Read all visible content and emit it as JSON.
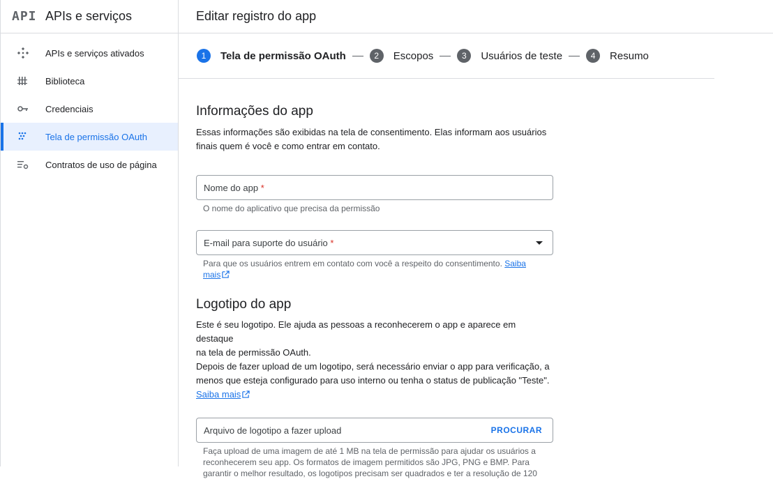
{
  "sidebar": {
    "logo": "API",
    "title": "APIs e serviços",
    "items": [
      {
        "label": "APIs e serviços ativados",
        "icon": "dashboard-diamond-icon"
      },
      {
        "label": "Biblioteca",
        "icon": "library-icon"
      },
      {
        "label": "Credenciais",
        "icon": "key-icon"
      },
      {
        "label": "Tela de permissão OAuth",
        "icon": "consent-dots-icon",
        "active": true
      },
      {
        "label": "Contratos de uso de página",
        "icon": "settings-list-icon"
      }
    ]
  },
  "header": {
    "title": "Editar registro do app"
  },
  "stepper": {
    "steps": [
      {
        "num": "1",
        "label": "Tela de permissão OAuth",
        "current": true
      },
      {
        "num": "2",
        "label": "Escopos"
      },
      {
        "num": "3",
        "label": "Usuários de teste"
      },
      {
        "num": "4",
        "label": "Resumo"
      }
    ]
  },
  "app_info": {
    "heading": "Informações do app",
    "desc_line1": "Essas informações são exibidas na tela de consentimento. Elas informam aos usuários",
    "desc_line2": "finais quem é você e como entrar em contato.",
    "app_name": {
      "placeholder": "Nome do app",
      "required": "*",
      "hint": "O nome do aplicativo que precisa da permissão"
    },
    "support_email": {
      "placeholder": "E-mail para suporte do usuário",
      "required": "*",
      "hint": "Para que os usuários entrem em contato com você a respeito do consentimento.",
      "link1": "Saiba",
      "link2": "mais"
    }
  },
  "logo_section": {
    "heading": "Logotipo do app",
    "line1": "Este é seu logotipo. Ele ajuda as pessoas a reconhecerem o app e aparece em destaque",
    "line2": "na tela de permissão OAuth.",
    "line3": "Depois de fazer upload de um logotipo, será necessário enviar o app para verificação, a",
    "line4": "menos que esteja configurado para uso interno ou tenha o status de publicação \"Teste\".",
    "learn_more": "Saiba mais",
    "upload": {
      "placeholder": "Arquivo de logotipo a fazer upload",
      "button": "PROCURAR"
    },
    "hint1": "Faça upload de uma imagem de até 1 MB na tela de permissão para ajudar os usuários a",
    "hint2": "reconhecerem seu app. Os formatos de imagem permitidos são JPG, PNG e BMP. Para",
    "hint3": "garantir o melhor resultado, os logotipos precisam ser quadrados e ter a resolução de 120"
  }
}
